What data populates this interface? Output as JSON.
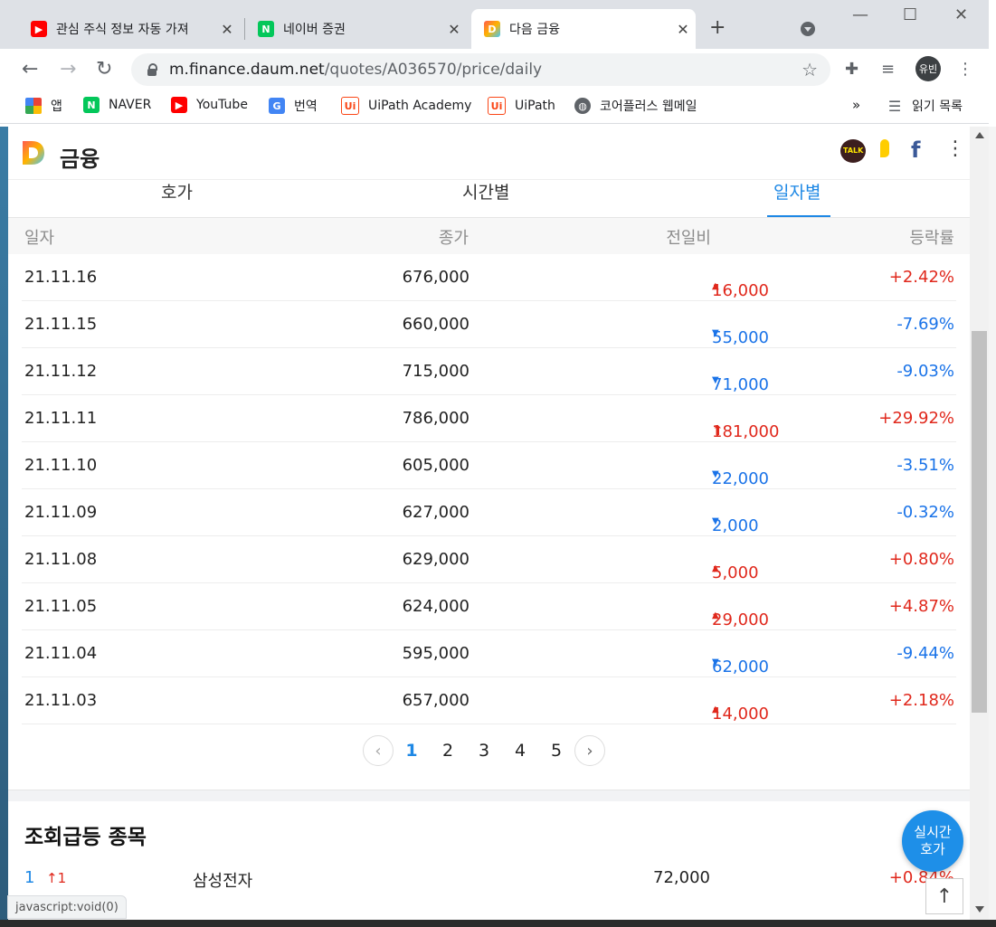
{
  "browser": {
    "tabs": [
      {
        "title": "관심 주식 정보 자동 가져",
        "favicon": "youtube-icon"
      },
      {
        "title": "네이버 증권",
        "favicon": "naver-icon"
      },
      {
        "title": "다음 금융",
        "favicon": "daum-icon"
      }
    ],
    "url_host": "m.finance.daum.net",
    "url_path": "/quotes/A036570/price/daily",
    "avatar_label": "유빈",
    "bookmarks": [
      {
        "label": "앱"
      },
      {
        "label": "NAVER"
      },
      {
        "label": "YouTube"
      },
      {
        "label": "번역"
      },
      {
        "label": "UiPath Academy"
      },
      {
        "label": "UiPath"
      },
      {
        "label": "코어플러스 웹메일"
      }
    ],
    "more_label": "»",
    "reading_list_label": "읽기 목록",
    "status_text": "javascript:void(0)"
  },
  "header": {
    "brand": "금융",
    "talk_label": "TALK"
  },
  "subtabs": {
    "quote": "호가",
    "hourly": "시간별",
    "daily": "일자별"
  },
  "table": {
    "headers": {
      "date": "일자",
      "close": "종가",
      "diff": "전일비",
      "rate": "등락률"
    },
    "rows": [
      {
        "date": "21.11.16",
        "close": "676,000",
        "diff": "16,000",
        "rate": "+2.42%",
        "dir": "up"
      },
      {
        "date": "21.11.15",
        "close": "660,000",
        "diff": "55,000",
        "rate": "-7.69%",
        "dir": "down"
      },
      {
        "date": "21.11.12",
        "close": "715,000",
        "diff": "71,000",
        "rate": "-9.03%",
        "dir": "down"
      },
      {
        "date": "21.11.11",
        "close": "786,000",
        "diff": "181,000",
        "rate": "+29.92%",
        "dir": "upper"
      },
      {
        "date": "21.11.10",
        "close": "605,000",
        "diff": "22,000",
        "rate": "-3.51%",
        "dir": "down"
      },
      {
        "date": "21.11.09",
        "close": "627,000",
        "diff": "2,000",
        "rate": "-0.32%",
        "dir": "down"
      },
      {
        "date": "21.11.08",
        "close": "629,000",
        "diff": "5,000",
        "rate": "+0.80%",
        "dir": "up"
      },
      {
        "date": "21.11.05",
        "close": "624,000",
        "diff": "29,000",
        "rate": "+4.87%",
        "dir": "up"
      },
      {
        "date": "21.11.04",
        "close": "595,000",
        "diff": "62,000",
        "rate": "-9.44%",
        "dir": "down"
      },
      {
        "date": "21.11.03",
        "close": "657,000",
        "diff": "14,000",
        "rate": "+2.18%",
        "dir": "up"
      }
    ]
  },
  "pagination": {
    "pages": [
      "1",
      "2",
      "3",
      "4",
      "5"
    ],
    "current": "1"
  },
  "trending": {
    "title": "조회급등 종목",
    "rank": "1",
    "rank_change": "1",
    "name": "삼성전자",
    "price": "72,000",
    "rate": "+0.84%"
  },
  "fab": {
    "line1": "실시간",
    "line2": "호가"
  },
  "colors": {
    "up": "#e0281c",
    "down": "#1a73e8",
    "accent": "#1e88e5"
  }
}
